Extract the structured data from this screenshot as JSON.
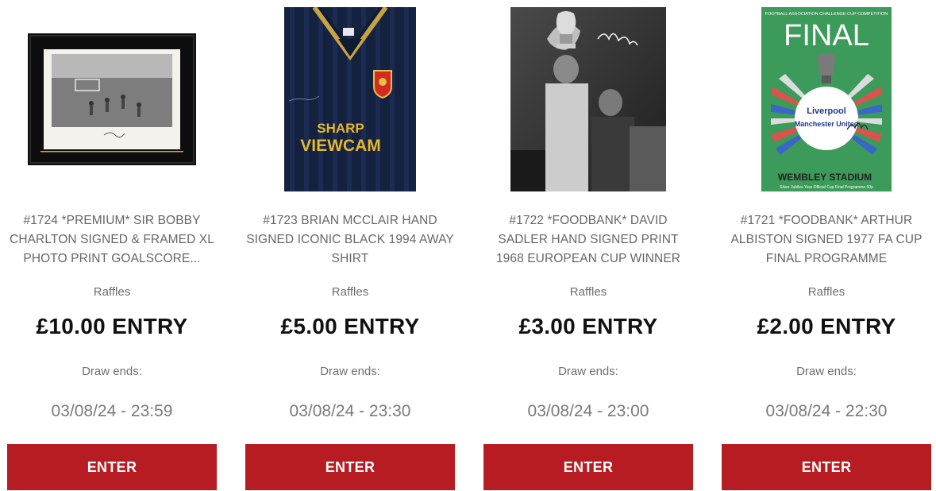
{
  "products": [
    {
      "title": "#1724 *PREMIUM* SIR BOBBY CHARLTON SIGNED & FRAMED XL PHOTO PRINT GOALSCORE...",
      "category": "Raffles",
      "price": "£10.00 ENTRY",
      "draw_label": "Draw ends:",
      "draw_date": "03/08/24 - 23:59",
      "button": "ENTER",
      "image": "framed-signed-photo"
    },
    {
      "title": "#1723 BRIAN MCCLAIR HAND SIGNED ICONIC BLACK 1994 AWAY SHIRT",
      "category": "Raffles",
      "price": "£5.00 ENTRY",
      "draw_label": "Draw ends:",
      "draw_date": "03/08/24 - 23:30",
      "button": "ENTER",
      "image": "signed-away-shirt",
      "shirt_sponsor_line1": "SHARP",
      "shirt_sponsor_line2": "VIEWCAM"
    },
    {
      "title": "#1722 *FOODBANK* DAVID SADLER HAND SIGNED PRINT 1968 EUROPEAN CUP WINNER",
      "category": "Raffles",
      "price": "£3.00 ENTRY",
      "draw_label": "Draw ends:",
      "draw_date": "03/08/24 - 23:00",
      "button": "ENTER",
      "image": "signed-trophy-photo"
    },
    {
      "title": "#1721 *FOODBANK* ARTHUR ALBISTON SIGNED 1977 FA CUP FINAL PROGRAMME",
      "category": "Raffles",
      "price": "£2.00 ENTRY",
      "draw_label": "Draw ends:",
      "draw_date": "03/08/24 - 22:30",
      "button": "ENTER",
      "image": "signed-programme",
      "programme": {
        "header": "FOOTBALL ASSOCIATION CHALLENGE CUP COMPETITION",
        "word": "FINAL",
        "team1": "Liverpool",
        "team2": "Manchester United",
        "venue": "WEMBLEY STADIUM",
        "footer": "Silver Jubilee Year Official Cup Final Programme 50p"
      }
    }
  ],
  "colors": {
    "button_bg": "#b71c22",
    "title_text": "#666666",
    "price_text": "#111111"
  }
}
